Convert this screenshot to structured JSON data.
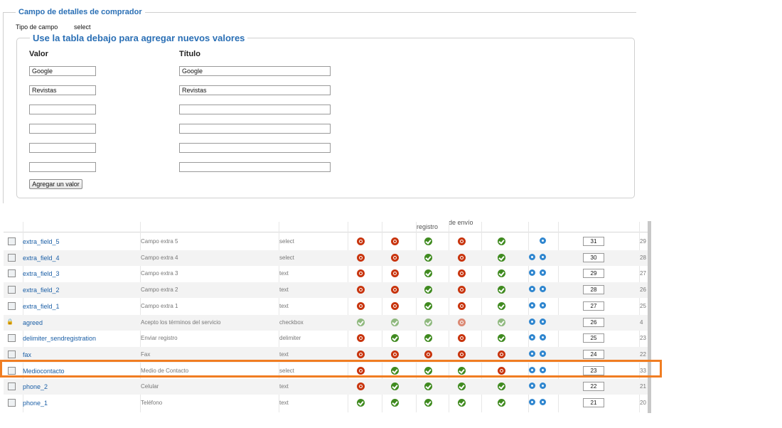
{
  "fieldset": {
    "legend": "Campo de detalles de comprador",
    "field_type_label": "Tipo de campo",
    "field_type_value": "select",
    "values_legend": "Use la tabla debajo para agregar nuevos valores",
    "col_value": "Valor",
    "col_title": "Título",
    "rows": [
      {
        "value": "Google",
        "title": "Google"
      },
      {
        "value": "Revistas",
        "title": "Revistas"
      },
      {
        "value": "",
        "title": ""
      },
      {
        "value": "",
        "title": ""
      },
      {
        "value": "",
        "title": ""
      },
      {
        "value": "",
        "title": ""
      }
    ],
    "add_button": "Agregar un valor"
  },
  "table": {
    "headers": {
      "col4": "registro",
      "col5": "de envío"
    },
    "rows": [
      {
        "name": "extra_field_5",
        "title": "Campo extra 5",
        "type": "select",
        "flags": [
          "red",
          "red",
          "green",
          "red",
          "green"
        ],
        "arrows": [
          "down"
        ],
        "order": "31",
        "id": "29",
        "locked": false
      },
      {
        "name": "extra_field_4",
        "title": "Campo extra 4",
        "type": "select",
        "flags": [
          "red",
          "red",
          "green",
          "red",
          "green"
        ],
        "arrows": [
          "up",
          "down"
        ],
        "order": "30",
        "id": "28",
        "locked": false
      },
      {
        "name": "extra_field_3",
        "title": "Campo extra 3",
        "type": "text",
        "flags": [
          "red",
          "red",
          "green",
          "red",
          "green"
        ],
        "arrows": [
          "up",
          "down"
        ],
        "order": "29",
        "id": "27",
        "locked": false
      },
      {
        "name": "extra_field_2",
        "title": "Campo extra 2",
        "type": "text",
        "flags": [
          "red",
          "red",
          "green",
          "red",
          "green"
        ],
        "arrows": [
          "up",
          "down"
        ],
        "order": "28",
        "id": "26",
        "locked": false
      },
      {
        "name": "extra_field_1",
        "title": "Campo extra 1",
        "type": "text",
        "flags": [
          "red",
          "red",
          "green",
          "red",
          "green"
        ],
        "arrows": [
          "up",
          "down"
        ],
        "order": "27",
        "id": "25",
        "locked": false
      },
      {
        "name": "agreed",
        "title": "Acepto los términos del servicio",
        "type": "checkbox",
        "flags": [
          "green",
          "green",
          "green",
          "red",
          "green"
        ],
        "arrows": [
          "up",
          "down"
        ],
        "order": "26",
        "id": "4",
        "locked": true
      },
      {
        "name": "delimiter_sendregistration",
        "title": "Enviar registro",
        "type": "delimiter",
        "flags": [
          "red",
          "green",
          "green",
          "red",
          "green"
        ],
        "arrows": [
          "up",
          "down"
        ],
        "order": "25",
        "id": "23",
        "locked": false
      },
      {
        "name": "fax",
        "title": "Fax",
        "type": "text",
        "flags": [
          "red",
          "red",
          "red",
          "red",
          "red"
        ],
        "arrows": [
          "up",
          "down"
        ],
        "order": "24",
        "id": "22",
        "locked": false
      },
      {
        "name": "Mediocontacto",
        "title": "Medio de Contacto",
        "type": "select",
        "flags": [
          "red",
          "green",
          "green",
          "green",
          "red"
        ],
        "arrows": [
          "up",
          "down"
        ],
        "order": "23",
        "id": "33",
        "locked": false
      },
      {
        "name": "phone_2",
        "title": "Celular",
        "type": "text",
        "flags": [
          "red",
          "green",
          "green",
          "green",
          "green"
        ],
        "arrows": [
          "up",
          "down"
        ],
        "order": "22",
        "id": "21",
        "locked": false
      },
      {
        "name": "phone_1",
        "title": "Teléfono",
        "type": "text",
        "flags": [
          "green",
          "green",
          "green",
          "green",
          "green"
        ],
        "arrows": [
          "up",
          "down"
        ],
        "order": "21",
        "id": "20",
        "locked": false
      }
    ]
  }
}
